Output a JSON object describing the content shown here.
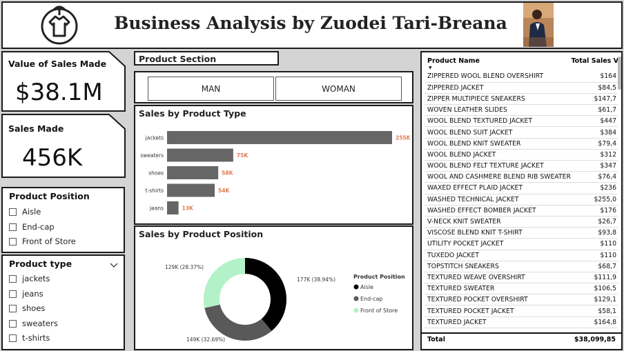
{
  "header": {
    "title": "Business Analysis by Zuodei Tari-Breana"
  },
  "kpis": {
    "value_of_sales_label": "Value of Sales Made",
    "value_of_sales_value": "$38.1M",
    "sales_made_label": "Sales Made",
    "sales_made_value": "456K"
  },
  "product_position_slicer": {
    "title": "Product Position",
    "items": [
      "Aisle",
      "End-cap",
      "Front of Store"
    ]
  },
  "product_type_slicer": {
    "title": "Product type",
    "items": [
      "jackets",
      "jeans",
      "shoes",
      "sweaters",
      "t-shirts"
    ]
  },
  "product_section": {
    "title": "Product Section",
    "buttons": [
      "MAN",
      "WOMAN"
    ]
  },
  "colors": {
    "bar": "#666666",
    "bar_label": "#e07a4f",
    "aisle": "#000000",
    "endcap": "#595959",
    "front": "#b3f2c8"
  },
  "chart_data": [
    {
      "type": "bar",
      "title": "Sales by Product Type",
      "categories": [
        "jackets",
        "sweaters",
        "shoes",
        "t-shirts",
        "jeans"
      ],
      "values": [
        255,
        75,
        58,
        54,
        13
      ],
      "data_labels": [
        "255K",
        "75K",
        "58K",
        "54K",
        "13K"
      ],
      "orientation": "horizontal"
    },
    {
      "type": "pie",
      "title": "Sales by Product Position",
      "legend_title": "Product Position",
      "legend_position": "right",
      "categories": [
        "Aisle",
        "End-cap",
        "Front of Store"
      ],
      "values": [
        177,
        149,
        129
      ],
      "data_labels": [
        "177K (38.94%)",
        "149K (32.69%)",
        "129K (28.37%)"
      ]
    }
  ],
  "table": {
    "col_name": "Product Name",
    "col_value": "Total Sales V",
    "rows": [
      [
        "ZIPPERED WOOL BLEND OVERSHIRT",
        "$164"
      ],
      [
        "ZIPPERED JACKET",
        "$84,5"
      ],
      [
        "ZIPPER MULTIPIECE SNEAKERS",
        "$147,7"
      ],
      [
        "WOVEN LEATHER SLIDES",
        "$61,7"
      ],
      [
        "WOOL BLEND TEXTURED JACKET",
        "$447"
      ],
      [
        "WOOL BLEND SUIT JACKET",
        "$384"
      ],
      [
        "WOOL BLEND KNIT SWEATER",
        "$79,4"
      ],
      [
        "WOOL BLEND JACKET",
        "$312"
      ],
      [
        "WOOL BLEND FELT TEXTURE JACKET",
        "$347"
      ],
      [
        "WOOL AND CASHMERE BLEND RIB SWEATER",
        "$76,4"
      ],
      [
        "WAXED EFFECT PLAID JACKET",
        "$236"
      ],
      [
        "WASHED TECHNICAL JACKET",
        "$255,0"
      ],
      [
        "WASHED EFFECT BOMBER JACKET",
        "$176"
      ],
      [
        "V-NECK KNIT SWEATER",
        "$26,7"
      ],
      [
        "VISCOSE BLEND KNIT T-SHIRT",
        "$93,8"
      ],
      [
        "UTILITY POCKET JACKET",
        "$110"
      ],
      [
        "TUXEDO JACKET",
        "$110"
      ],
      [
        "TOPSTITCH SNEAKERS",
        "$68,7"
      ],
      [
        "TEXTURED WEAVE OVERSHIRT",
        "$111,9"
      ],
      [
        "TEXTURED SWEATER",
        "$106,5"
      ],
      [
        "TEXTURED POCKET OVERSHIRT",
        "$129,1"
      ],
      [
        "TEXTURED POCKET JACKET",
        "$58,1"
      ],
      [
        "TEXTURED JACKET",
        "$164,8"
      ]
    ],
    "total_label": "Total",
    "total_value": "$38,099,85"
  }
}
